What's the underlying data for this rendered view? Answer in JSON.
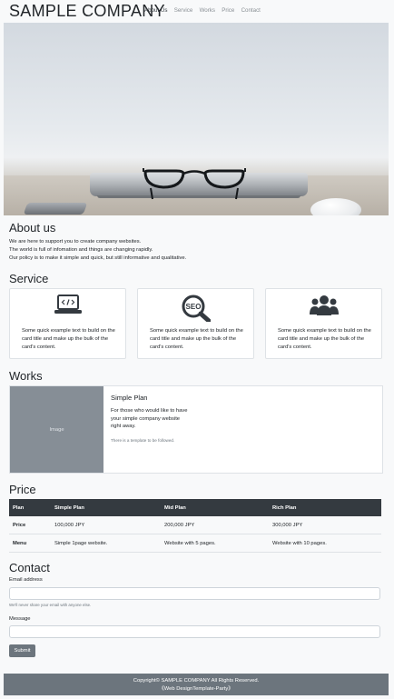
{
  "header": {
    "brand": "SAMPLE COMPANY",
    "nav": [
      "About Us",
      "Service",
      "Works",
      "Price",
      "Contact"
    ]
  },
  "about": {
    "title": "About us",
    "lines": [
      "We are here to support you to create company websites.",
      "The world is full of infomation and things are changing rapidly.",
      "Our policy is to make it simple and quick, but still informative and qualitative."
    ]
  },
  "service": {
    "title": "Service",
    "cards": [
      {
        "icon": "laptop-code-icon",
        "text": "Some quick example text to build on the card title and make up the bulk of the card's content."
      },
      {
        "icon": "seo-search-icon",
        "text": "Some quick example text to build on the card title and make up the bulk of the card's content."
      },
      {
        "icon": "users-icon",
        "text": "Some quick example text to build on the card title and make up the bulk of the card's content."
      }
    ]
  },
  "works": {
    "title": "Works",
    "image_label": "Image",
    "card_title": "Simple Plan",
    "card_text": "For those who would like to have your simple company website right away.",
    "card_note": "There is a template to be followed."
  },
  "price": {
    "title": "Price",
    "headers": [
      "Plan",
      "Simple Plan",
      "Mid Plan",
      "Rich Plan"
    ],
    "rows": [
      [
        "Price",
        "100,000 JPY",
        "200,000 JPY",
        "300,000 JPY"
      ],
      [
        "Menu",
        "Simple 1page website.",
        "Website with 5 pages.",
        "Website with 10 pages."
      ]
    ]
  },
  "contact": {
    "title": "Contact",
    "email_label": "Email address",
    "email_value": "",
    "email_help": "We'll never share your email with anyone else.",
    "message_label": "Message",
    "message_value": "",
    "submit_label": "Submit"
  },
  "footer": {
    "copyright": "Copyright© SAMPLE COMPANY All Rights Reserved.",
    "credit": "《Web DesignTemplate-Party》"
  },
  "colors": {
    "background": "#f8f9fa",
    "table_header": "#343a40",
    "footer": "#6c757d",
    "image_placeholder": "#868e96",
    "icon": "#343a40"
  }
}
